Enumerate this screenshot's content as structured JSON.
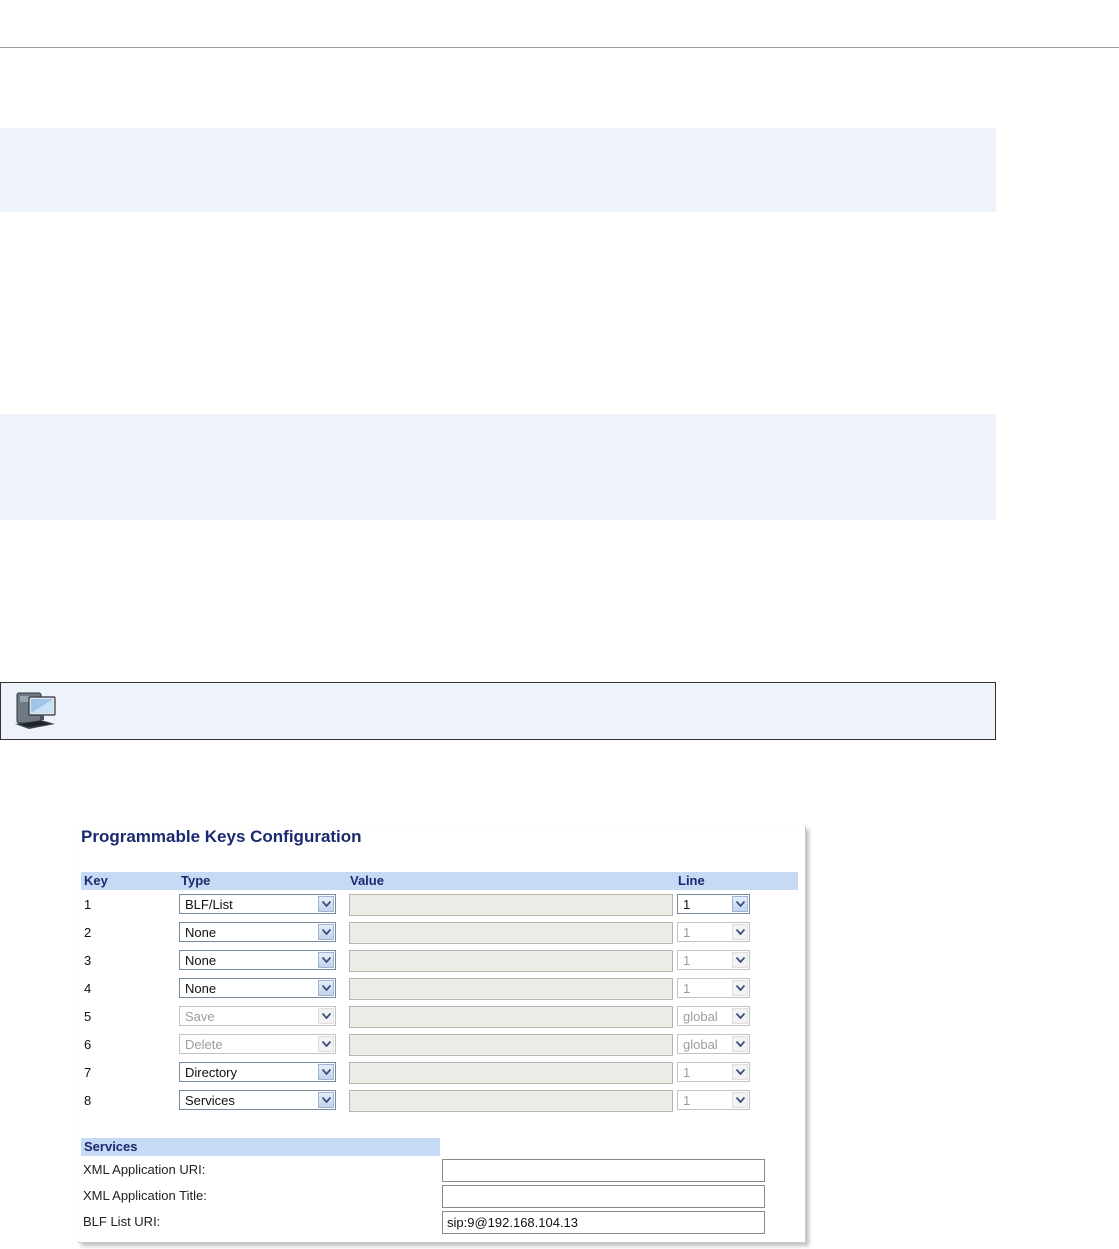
{
  "panel": {
    "title": "Programmable Keys Configuration",
    "columns": {
      "key": "Key",
      "type": "Type",
      "value": "Value",
      "line": "Line"
    },
    "rows": [
      {
        "key": "1",
        "type": "BLF/List",
        "type_enabled": true,
        "value": "",
        "line": "1",
        "line_enabled": true
      },
      {
        "key": "2",
        "type": "None",
        "type_enabled": true,
        "value": "",
        "line": "1",
        "line_enabled": false
      },
      {
        "key": "3",
        "type": "None",
        "type_enabled": true,
        "value": "",
        "line": "1",
        "line_enabled": false
      },
      {
        "key": "4",
        "type": "None",
        "type_enabled": true,
        "value": "",
        "line": "1",
        "line_enabled": false
      },
      {
        "key": "5",
        "type": "Save",
        "type_enabled": false,
        "value": "",
        "line": "global",
        "line_enabled": false
      },
      {
        "key": "6",
        "type": "Delete",
        "type_enabled": false,
        "value": "",
        "line": "global",
        "line_enabled": false
      },
      {
        "key": "7",
        "type": "Directory",
        "type_enabled": true,
        "value": "",
        "line": "1",
        "line_enabled": false
      },
      {
        "key": "8",
        "type": "Services",
        "type_enabled": true,
        "value": "",
        "line": "1",
        "line_enabled": false
      }
    ],
    "services": {
      "header": "Services",
      "xml_uri_label": "XML Application URI:",
      "xml_uri_value": "",
      "xml_title_label": "XML Application Title:",
      "xml_title_value": "",
      "blf_uri_label": "BLF List URI:",
      "blf_uri_value": "sip:9@192.168.104.13"
    }
  },
  "icons": {
    "note": "computer-workstation-icon",
    "dropdown": "chevron-down-icon"
  },
  "colors": {
    "header_bg": "#c7daf5",
    "title": "#1a2a6e",
    "band_bg": "#eef3fa"
  }
}
